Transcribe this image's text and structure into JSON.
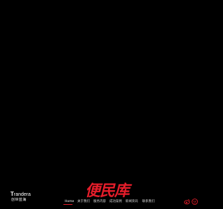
{
  "brand": {
    "logo_word_lead": "T",
    "logo_word_rest": "randera",
    "logo_subtitle": "创世蓝海"
  },
  "watermark": {
    "text": "便民库",
    "color": "#e51d2a"
  },
  "nav": {
    "items": [
      {
        "label": "Home",
        "active": true
      },
      {
        "label": "关于我们",
        "active": false
      },
      {
        "label": "服务内容",
        "active": false
      },
      {
        "label": "成功案例",
        "active": false
      },
      {
        "label": "新闻资讯",
        "active": false
      },
      {
        "label": "联系我们",
        "active": false
      }
    ]
  },
  "social": {
    "icons": [
      "weibo-icon",
      "wechat-icon"
    ],
    "accent": "#e51d2a"
  },
  "colors": {
    "background": "#000000",
    "accent": "#e51d2a",
    "text": "#ffffff"
  }
}
